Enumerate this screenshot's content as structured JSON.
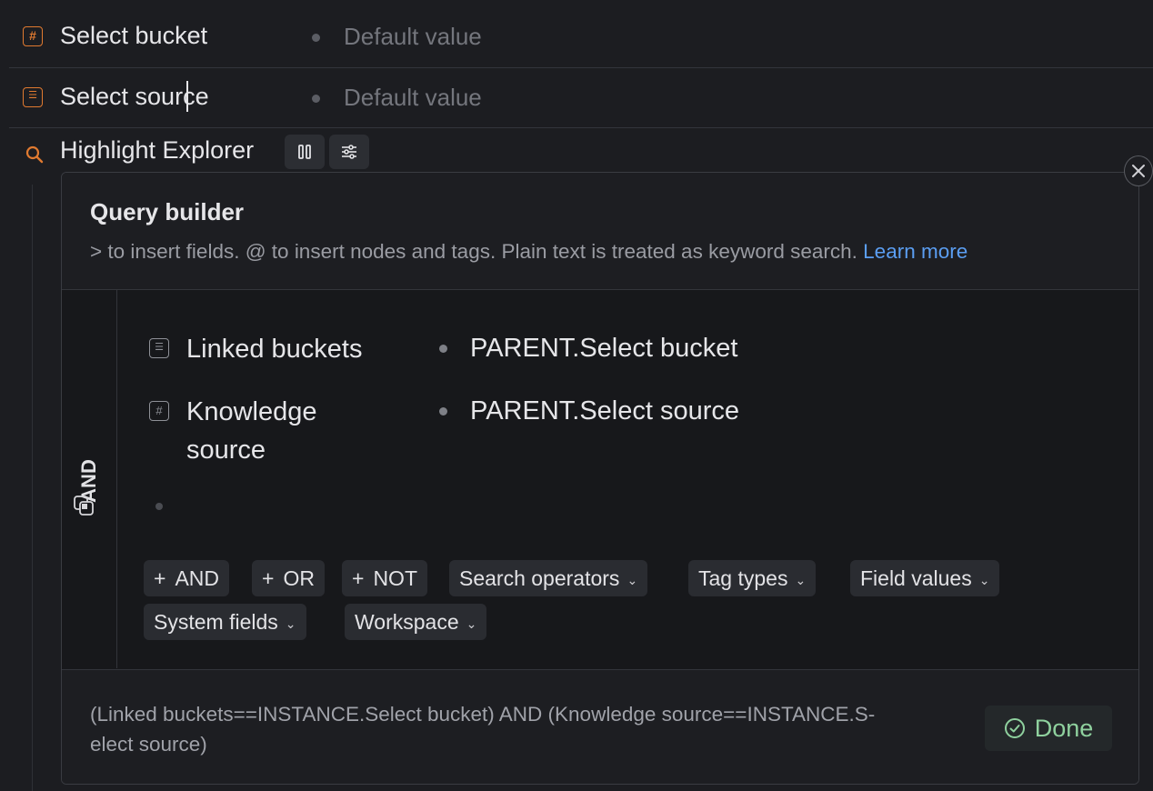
{
  "fields": [
    {
      "label": "Select bucket",
      "placeholder": "Default value",
      "icon": "number-icon"
    },
    {
      "label": "Select source",
      "placeholder": "Default value",
      "icon": "list-icon"
    }
  ],
  "explorer": {
    "title": "Highlight Explorer"
  },
  "query_builder": {
    "title": "Query builder",
    "help_text": "> to insert fields. @ to insert nodes and tags. Plain text is treated as keyword search.",
    "learn_more": "Learn more",
    "group_operator": "AND",
    "conditions": [
      {
        "field": "Linked buckets",
        "value": "PARENT.Select bucket",
        "icon": "list-icon"
      },
      {
        "field": "Knowledge source",
        "value": "PARENT.Select source",
        "icon": "number-icon"
      }
    ],
    "chips": {
      "and": "AND",
      "or": "OR",
      "not": "NOT",
      "search_operators": "Search operators",
      "tag_types": "Tag types",
      "field_values": "Field values",
      "system_fields": "System fields",
      "workspace": "Workspace"
    },
    "expression_line1": "(Linked buckets==INSTANCE.Select bucket) AND (Knowledge source==INSTANCE.S-",
    "expression_line2": "elect source)",
    "done_label": "Done"
  },
  "colors": {
    "accent_orange": "#e07a30",
    "link_blue": "#5b9ef2",
    "done_green": "#8fd19e"
  }
}
